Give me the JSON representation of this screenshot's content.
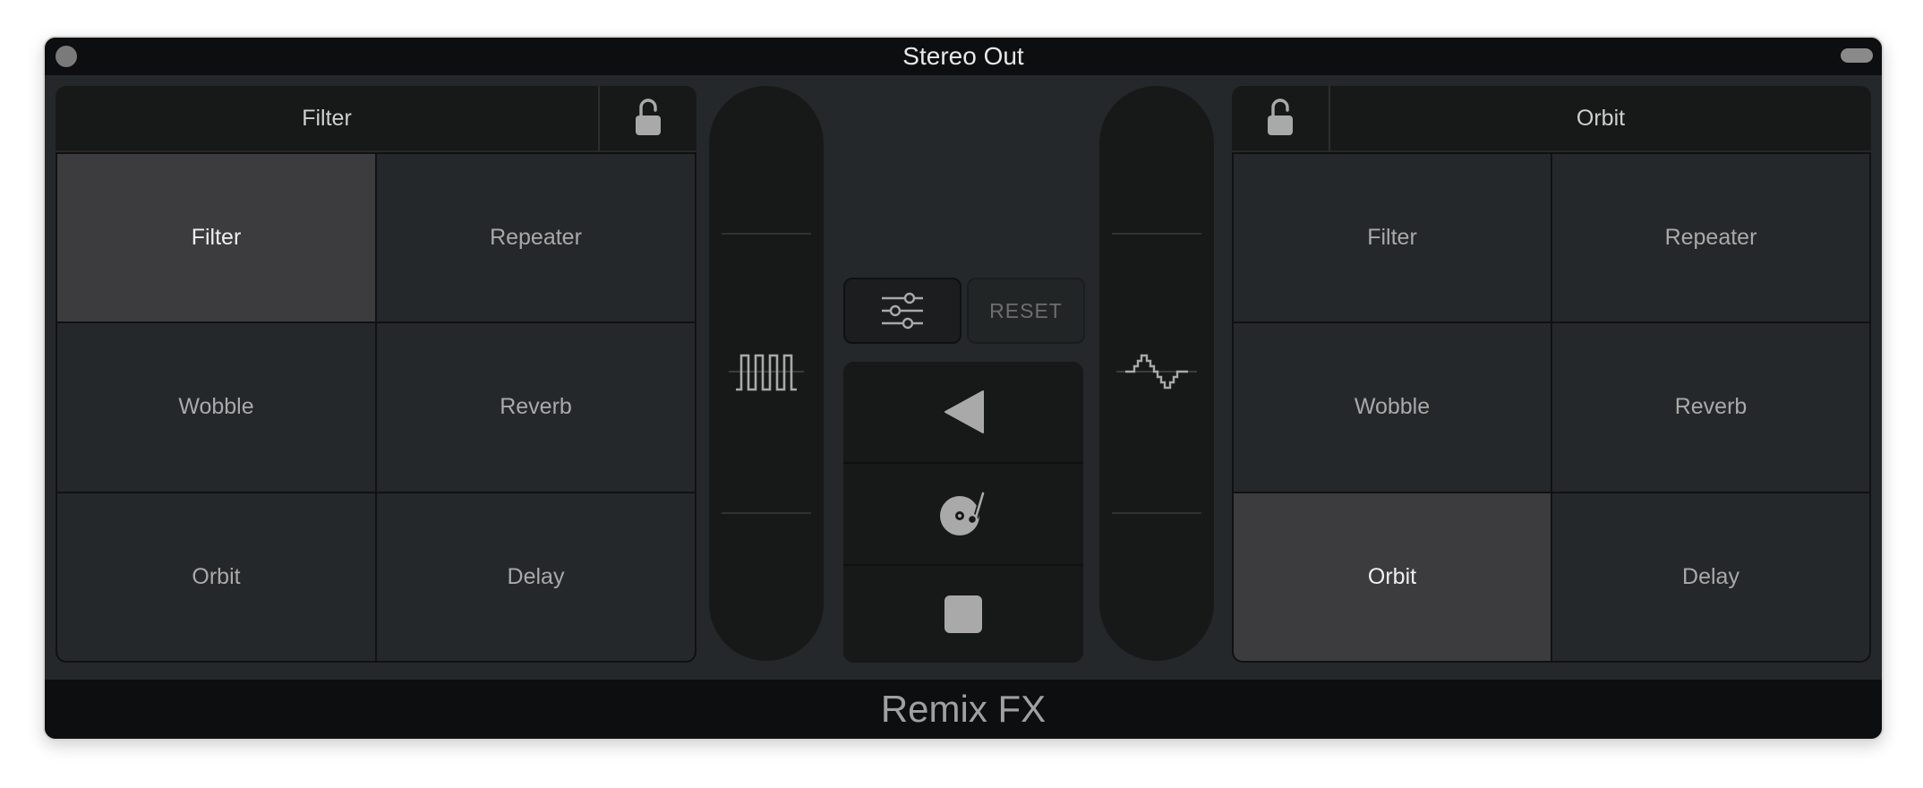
{
  "window": {
    "title": "Stereo Out",
    "footer": "Remix FX"
  },
  "left_panel": {
    "selected_effect": "Filter",
    "effects": [
      "Filter",
      "Repeater",
      "Wobble",
      "Reverb",
      "Orbit",
      "Delay"
    ],
    "active_effect": "Filter"
  },
  "right_panel": {
    "selected_effect": "Orbit",
    "effects": [
      "Filter",
      "Repeater",
      "Wobble",
      "Reverb",
      "Orbit",
      "Delay"
    ],
    "active_effect": "Orbit"
  },
  "left_slider": {
    "icon": "square-wave-icon"
  },
  "right_slider": {
    "icon": "stepped-sine-wave-icon"
  },
  "controls": {
    "settings_icon": "sliders-icon",
    "reset_label": "RESET",
    "transport_icons": [
      "reverse-play-icon",
      "turntable-icon",
      "stop-icon"
    ]
  },
  "colors": {
    "background": "#25282a",
    "bar": "#0d0e0f",
    "active_cell": "#3c3c3f",
    "text": "#a9a9a9"
  }
}
